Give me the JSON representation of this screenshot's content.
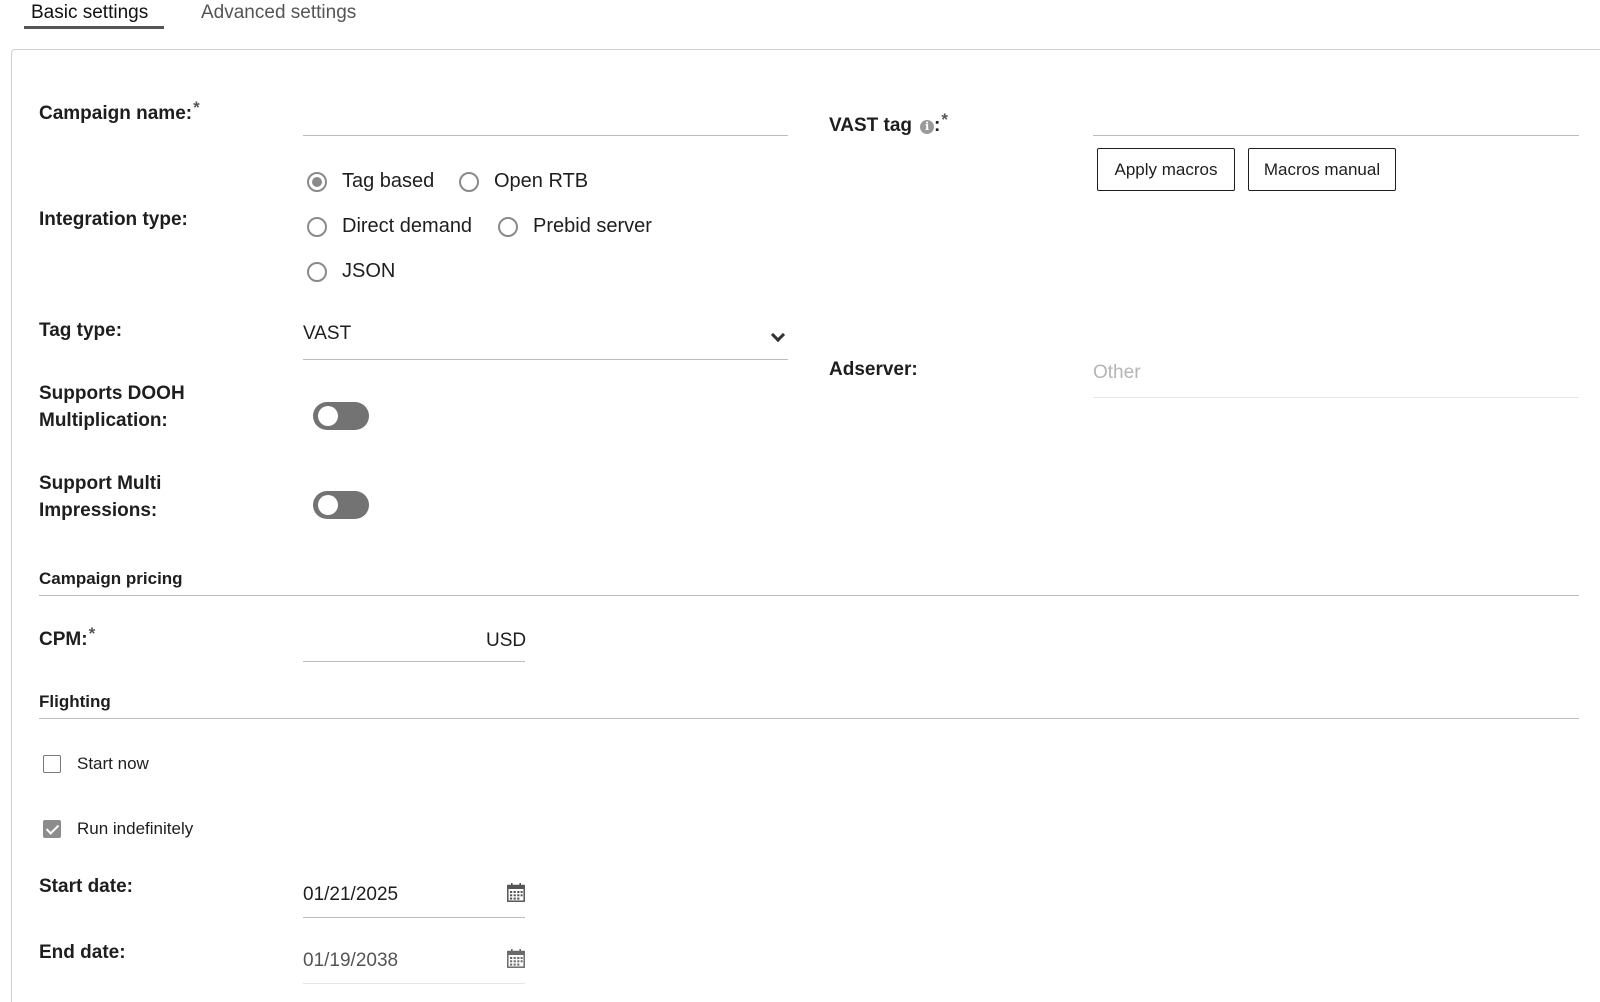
{
  "tabs": {
    "basic": "Basic settings",
    "advanced": "Advanced settings"
  },
  "form": {
    "campaign_name": {
      "label": "Campaign name:",
      "required": "*",
      "value": ""
    },
    "vast_tag": {
      "label": "VAST tag",
      "info_icon": "i",
      "colon": ":",
      "required": "*",
      "value": ""
    },
    "buttons": {
      "apply_macros": "Apply macros",
      "macros_manual": "Macros manual"
    },
    "integration_type": {
      "label": "Integration type:",
      "options": [
        "Tag based",
        "Open RTB",
        "Direct demand",
        "Prebid server",
        "JSON"
      ],
      "selected": "Tag based"
    },
    "tag_type": {
      "label": "Tag type:",
      "value": "VAST"
    },
    "adserver": {
      "label": "Adserver:",
      "placeholder": "Other"
    },
    "supports_dooh": {
      "label_line1": "Supports DOOH",
      "label_line2": "Multiplication:",
      "enabled": false
    },
    "support_multi": {
      "label_line1": "Support Multi",
      "label_line2": "Impressions:",
      "enabled": false
    }
  },
  "pricing": {
    "section_title": "Campaign pricing",
    "cpm": {
      "label": "CPM:",
      "required": "*",
      "value": "",
      "currency": "USD"
    }
  },
  "flighting": {
    "section_title": "Flighting",
    "start_now": {
      "label": "Start now",
      "checked": false
    },
    "run_indefinitely": {
      "label": "Run indefinitely",
      "checked": true
    },
    "start_date": {
      "label": "Start date:",
      "value": "01/21/2025"
    },
    "end_date": {
      "label": "End date:",
      "value": "01/19/2038"
    }
  },
  "icons": {
    "chevron": "chevron-down-icon",
    "calendar": "calendar-icon",
    "info": "info-icon"
  }
}
